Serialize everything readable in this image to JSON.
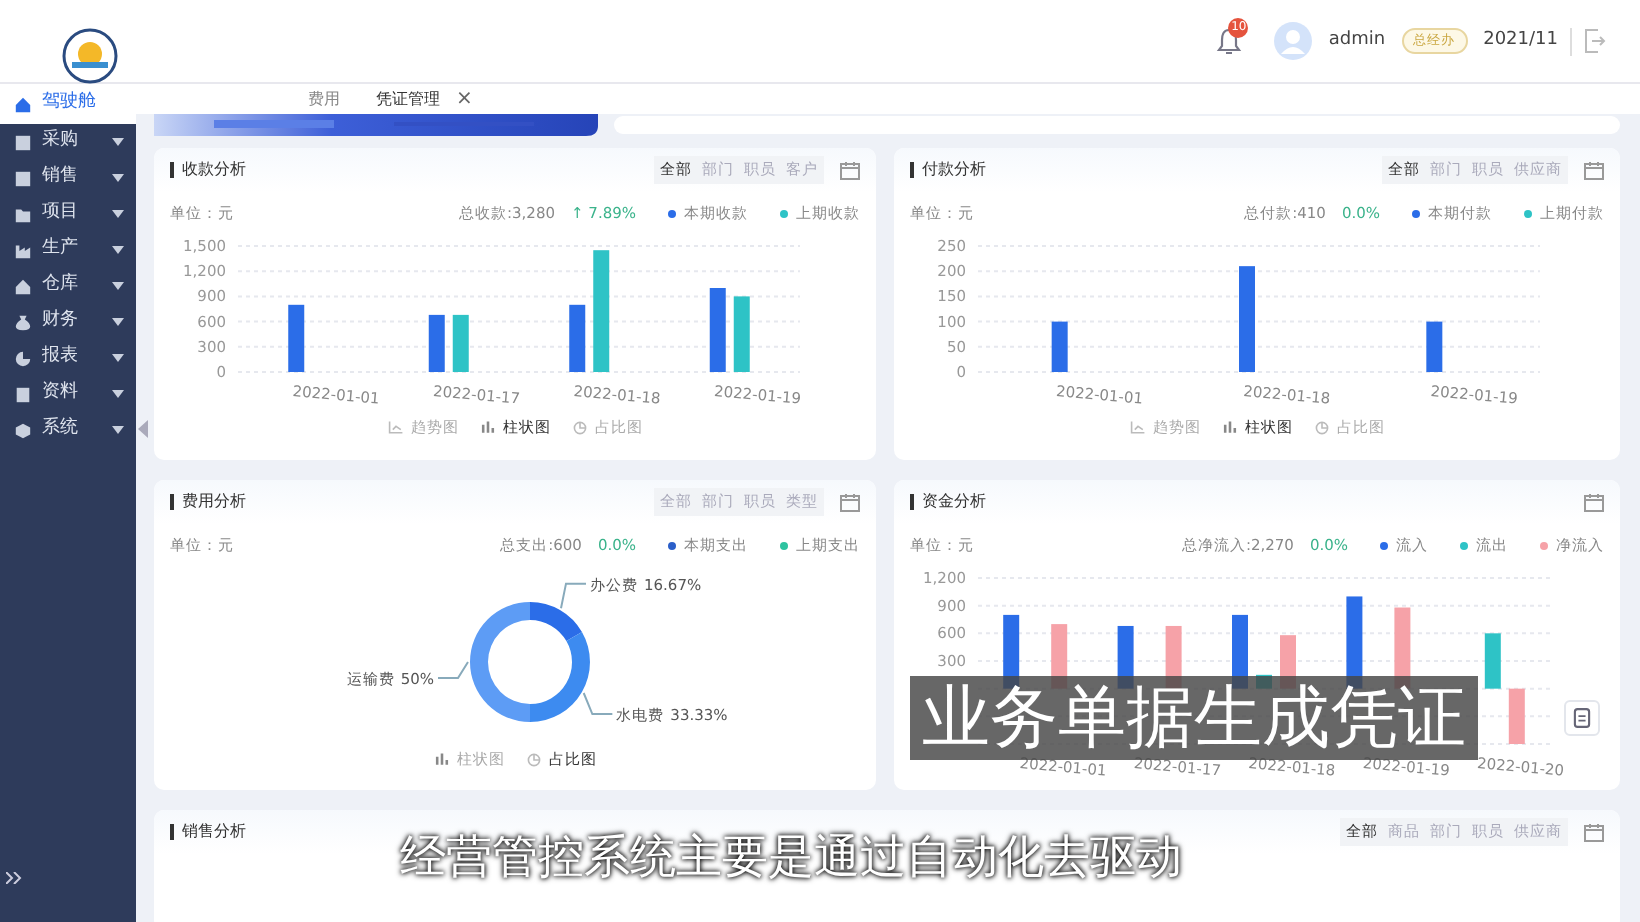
{
  "header": {
    "notifications": "10",
    "user": "admin",
    "role": "总经办",
    "period": "2021/11"
  },
  "sidebar": {
    "items": [
      {
        "label": "驾驶舱",
        "selected": true
      },
      {
        "label": "采购",
        "selected": false
      },
      {
        "label": "销售",
        "selected": false
      },
      {
        "label": "项目",
        "selected": false
      },
      {
        "label": "生产",
        "selected": false
      },
      {
        "label": "仓库",
        "selected": false
      },
      {
        "label": "财务",
        "selected": false
      },
      {
        "label": "报表",
        "selected": false
      },
      {
        "label": "资料",
        "selected": false
      },
      {
        "label": "系统",
        "selected": false
      }
    ]
  },
  "tabs": [
    {
      "label": "费用",
      "selected": false
    },
    {
      "label": "凭证管理",
      "selected": true,
      "close": "×"
    }
  ],
  "panels": [
    {
      "title": "收款分析",
      "filters": [
        {
          "label": "全部",
          "selected": true
        },
        {
          "label": "部门",
          "selected": false
        },
        {
          "label": "职员",
          "selected": false
        },
        {
          "label": "客户",
          "selected": false
        }
      ],
      "unit": "单位：元",
      "total": "总收款:3,280",
      "change": "↑ 7.89%",
      "chart_data": {
        "type": "bar",
        "grid": true,
        "categories": [
          "2022-01-01",
          "2022-01-17",
          "2022-01-18",
          "2022-01-19"
        ],
        "ylim": [
          0,
          1500
        ],
        "yticks": [
          0,
          {
            "value": 300,
            "label": "300"
          },
          {
            "value": 600,
            "label": "600"
          },
          {
            "value": 900,
            "label": "900"
          },
          {
            "value": 1200,
            "label": "1,200"
          },
          {
            "value": 1500,
            "label": "1,500"
          }
        ],
        "series": [
          {
            "name": "本期收款",
            "color": "#2b6de8",
            "values": [
              800,
              680,
              800,
              1000
            ]
          },
          {
            "name": "上期收款",
            "color": "#2ec3c6",
            "values": [
              null,
              680,
              1450,
              900
            ]
          }
        ]
      },
      "views": [
        {
          "label": "趋势图",
          "kind": "line",
          "selected": false
        },
        {
          "label": "柱状图",
          "kind": "bar",
          "selected": true
        },
        {
          "label": "占比图",
          "kind": "pie",
          "selected": false
        }
      ]
    },
    {
      "title": "付款分析",
      "filters": [
        {
          "label": "全部",
          "selected": true
        },
        {
          "label": "部门",
          "selected": false
        },
        {
          "label": "职员",
          "selected": false
        },
        {
          "label": "供应商",
          "selected": false
        }
      ],
      "unit": "单位：元",
      "total": "总付款:410",
      "change": "0.0%",
      "chart_data": {
        "type": "bar",
        "grid": true,
        "categories": [
          "2022-01-01",
          "2022-01-18",
          "2022-01-19"
        ],
        "ylim": [
          0,
          250
        ],
        "yticks": [
          0,
          50,
          100,
          150,
          200,
          250
        ],
        "series": [
          {
            "name": "本期付款",
            "color": "#2b6de8",
            "values": [
              100,
              210,
              100
            ]
          },
          {
            "name": "上期付款",
            "color": "#2ec3c6",
            "values": [
              null,
              null,
              null
            ]
          }
        ]
      },
      "views": [
        {
          "label": "趋势图",
          "kind": "line",
          "selected": false
        },
        {
          "label": "柱状图",
          "kind": "bar",
          "selected": true
        },
        {
          "label": "占比图",
          "kind": "pie",
          "selected": false
        }
      ]
    },
    {
      "title": "费用分析",
      "filters": [
        {
          "label": "全部",
          "selected": false
        },
        {
          "label": "部门",
          "selected": false
        },
        {
          "label": "职员",
          "selected": false
        },
        {
          "label": "类型",
          "selected": false
        }
      ],
      "unit": "单位：元",
      "total": "总支出:600",
      "change": "0.0%",
      "legend": [
        {
          "label": "本期支出",
          "color": "#2b5fc9"
        },
        {
          "label": "上期支出",
          "color": "#2ec3a0"
        }
      ],
      "chart_data": {
        "type": "donut",
        "categories": [
          "办公费",
          "水电费",
          "运输费"
        ],
        "values": [
          16.67,
          33.33,
          50
        ],
        "colors": [
          "#2b6de8",
          "#3d8bf0",
          "#5d9cf5"
        ],
        "value_labels": [
          "16.67%",
          "33.33%",
          "50%"
        ]
      },
      "views": [
        {
          "label": "柱状图",
          "kind": "bar",
          "selected": false
        },
        {
          "label": "占比图",
          "kind": "pie",
          "selected": true
        }
      ]
    },
    {
      "title": "资金分析",
      "unit": "单位：元",
      "total": "总净流入:2,270",
      "change": "0.0%",
      "chart_data": {
        "type": "bar",
        "grid": true,
        "categories": [
          "2022-01-01",
          "2022-01-17",
          "2022-01-18",
          "2022-01-19",
          "2022-01-20"
        ],
        "ylim": [
          -600,
          1200
        ],
        "yticks": [
          {
            "value": 300,
            "label": "300"
          },
          {
            "value": 600,
            "label": "600"
          },
          {
            "value": 900,
            "label": "900"
          },
          {
            "value": 1200,
            "label": "1,200"
          }
        ],
        "series": [
          {
            "name": "流入",
            "color": "#2b6de8",
            "values": [
              800,
              680,
              800,
              1000,
              null
            ]
          },
          {
            "name": "流出",
            "color": "#2ec3c6",
            "values": [
              null,
              null,
              150,
              null,
              600
            ]
          },
          {
            "name": "净流入",
            "color": "#f6a2a8",
            "values": [
              700,
              680,
              580,
              880,
              -600
            ]
          }
        ]
      }
    },
    {
      "title": "销售分析",
      "filters": [
        {
          "label": "全部",
          "selected": true
        },
        {
          "label": "商品",
          "selected": false
        },
        {
          "label": "部门",
          "selected": false
        },
        {
          "label": "职员",
          "selected": false
        },
        {
          "label": "供应商",
          "selected": false
        }
      ]
    }
  ],
  "subtitles": [
    "业务单据生成凭证",
    "经营管控系统主要是通过自动化去驱动"
  ]
}
